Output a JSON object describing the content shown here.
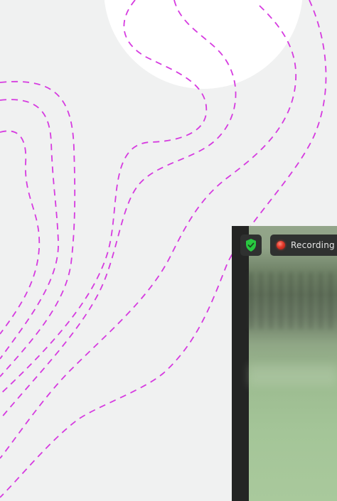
{
  "meeting_toolbar": {
    "recording_label": "Recording",
    "security_icon": "shield-check-icon",
    "record_icon": "record-dot-icon"
  },
  "colors": {
    "background": "#f0f1f1",
    "contour_lines": "#d63be0",
    "circle": "#ffffff",
    "shield_green": "#28c840",
    "record_red": "#e2382a"
  }
}
